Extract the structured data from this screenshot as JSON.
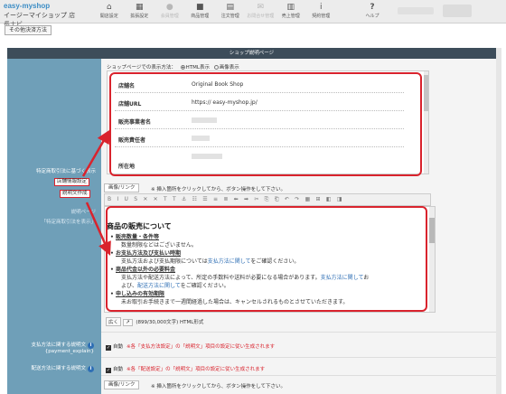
{
  "header": {
    "logo_text": "easy-myshop",
    "logo_sub": "イージーマイショップ",
    "logo_nav_label": "店長ナビ",
    "nav": [
      {
        "label": "開店設定",
        "icon": "home-icon",
        "enabled": true
      },
      {
        "label": "拡張設定",
        "icon": "grid-icon",
        "enabled": true
      },
      {
        "label": "会員管理",
        "icon": "user-icon",
        "enabled": false
      },
      {
        "label": "商品管理",
        "icon": "box-icon",
        "enabled": true
      },
      {
        "label": "注文管理",
        "icon": "document-icon",
        "enabled": true
      },
      {
        "label": "お問合せ管理",
        "icon": "mail-icon",
        "enabled": false
      },
      {
        "label": "売上管理",
        "icon": "chart-icon",
        "enabled": true
      },
      {
        "label": "契約管理",
        "icon": "info-icon",
        "enabled": true
      }
    ],
    "help_label": "ヘルプ"
  },
  "other_button": "その他決済方法",
  "section_title": "ショップ説明ページ",
  "left": {
    "tokusho_label": "特定商取引法に基づく表示",
    "tag_shop_info": "店舗情報設定",
    "tag_make_doc": "説明文作成",
    "preview_label_1": "説明ページ",
    "preview_label_2": "「特定商取引法を表示」",
    "payment_label": "支払方法に関する説明文",
    "payment_code": "{payment_explain}",
    "shipping_label": "配送方法に関する説明文"
  },
  "display_mode": {
    "label": "ショップページでの表示方法：",
    "options": [
      "HTML表示",
      "画像表示"
    ],
    "selected": "HTML表示"
  },
  "shop_info": [
    {
      "key": "店舗名",
      "value": "Original Book Shop"
    },
    {
      "key": "店舗URL",
      "value": "https://        easy-myshop.jp/"
    },
    {
      "key": "販売事業者名",
      "value": ""
    },
    {
      "key": "販売責任者",
      "value": ""
    },
    {
      "key": "所在地",
      "value": ""
    }
  ],
  "image_link_button": "画像/リンク",
  "insert_note": "※ 挿入箇所をクリックしてから、ボタン操作をして下さい。",
  "toolbar_text": "B I U S ✕ ✕ T T  ⚓ ☷ ☰ ≡ ≣ ⬅ ➡ ✂ ⎘ ⎗ ↶ ↷ ▦ ⊞ ◧ ◨",
  "editor": {
    "title": "商品の販売について",
    "items": [
      {
        "heading": "販売数量・条件等",
        "desc": "数量制限などはございません。",
        "link": ""
      },
      {
        "heading": "お支払方法及び支払い時期",
        "desc": "支払方法および支払期限については支払方法に関してをご確認ください。",
        "link": "支払方法に関して"
      },
      {
        "heading": "商品代金以外の必要料金",
        "desc": "支払方法や配送方法によって、所定の手数料や送料が必要になる場合があります。支払方法に関してお",
        "desc2": "よび、配送方法に関してをご確認ください。",
        "link": "配送方法に関して"
      },
      {
        "heading": "申し込みの有効期限",
        "desc": "未お取引お手続きまで一週間経過した場合は、キャンセルされるものとさせていただきます。",
        "link": ""
      }
    ]
  },
  "size_row": {
    "btn1": "広く",
    "btn2": "↗",
    "counter": "(899/30,000文字) HTML形式"
  },
  "auto_label": "自動",
  "payment_auto_note": "※各「支払方法設定」の「説明文」項目の設定に従い生成されます",
  "shipping_auto_note": "※各「配送設定」の「説明文」項目の設定に従い生成されます"
}
